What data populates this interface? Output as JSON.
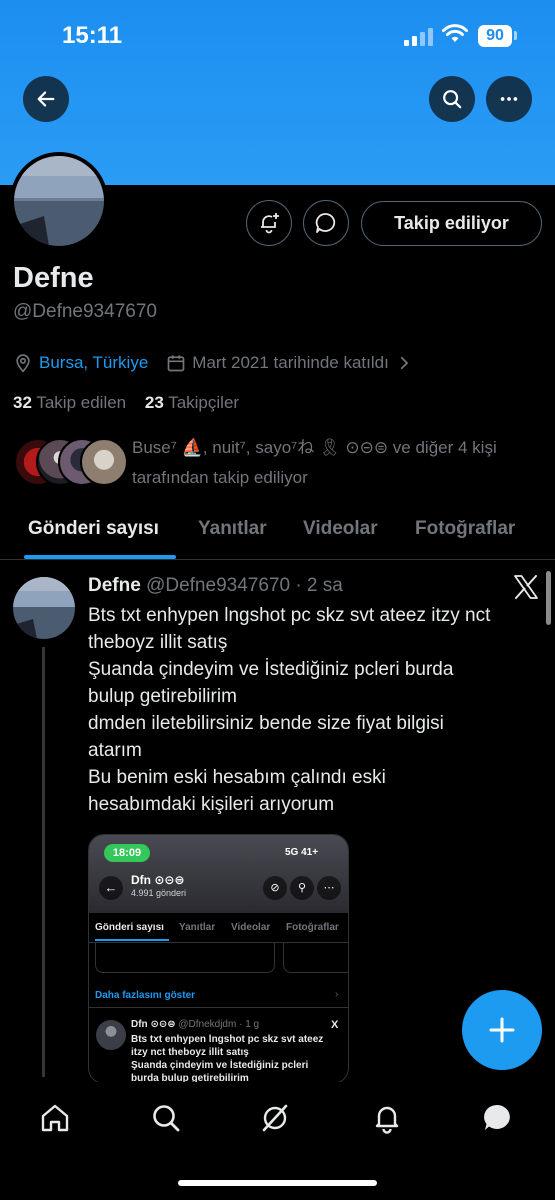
{
  "status_bar": {
    "time": "15:11",
    "battery": "90"
  },
  "profile": {
    "name": "Defne",
    "handle": "@Defne9347670",
    "location": "Bursa, Türkiye",
    "joined": "Mart 2021 tarihinde katıldı",
    "following_count": "32",
    "following_label": "Takip edilen",
    "followers_count": "23",
    "followers_label": "Takipçiler",
    "followed_by_line1": "Buse⁷ ⛵, nuit⁷, sayo⁷ね 🎗 ⊙⊝⊜ ve diğer 4 kişi",
    "followed_by_line2": "tarafından takip ediliyor",
    "follow_button": "Takip ediliyor"
  },
  "tabs": [
    "Gönderi sayısı",
    "Yanıtlar",
    "Videolar",
    "Fotoğraflar"
  ],
  "post": {
    "author": "Defne",
    "handle_time": "@Defne9347670 · 2 sa",
    "lines": [
      "Bts txt enhypen lngshot pc skz svt ateez itzy nct",
      "theboyz illit satış",
      "Şuanda çindeyim ve İstediğiniz pcleri burda",
      "bulup getirebilirim",
      "dmden iletebilirsiniz bende size fiyat bilgisi",
      "atarım",
      "Bu benim eski hesabım çalındı eski",
      "hesabımdaki kişileri arıyorum"
    ]
  },
  "embed": {
    "time": "18:09",
    "status": "5G 41+",
    "name": "Dfn ⊙⊝⊜",
    "sub": "4.991 gönderi",
    "tabs": [
      "Gönderi sayısı",
      "Yanıtlar",
      "Videolar",
      "Fotoğraflar"
    ],
    "show_more": "Daha fazlasını göster",
    "post_author": "Dfn ⊙⊝⊜",
    "post_handle": "@Dfnekdjdm · 1 g",
    "post_lines": [
      "Bts txt enhypen lngshot pc skz svt ateez",
      "itzy nct theboyz illit satış",
      "Şuanda çindeyim ve İstediğiniz pcleri",
      "burda bulup getirebilirim"
    ]
  },
  "icons": {
    "back": "arrow-left-icon",
    "search": "search-icon",
    "more": "more-horizontal-icon",
    "notify": "bell-plus-icon",
    "message": "chat-bubble-icon",
    "location": "location-pin-icon",
    "calendar": "calendar-icon",
    "compose": "plus-icon",
    "nav": [
      "home-icon",
      "search-icon",
      "grok-icon",
      "bell-icon",
      "messages-icon"
    ]
  },
  "colors": {
    "accent": "#1d9bf0",
    "banner": "#1c8ef0",
    "background": "#000000"
  }
}
